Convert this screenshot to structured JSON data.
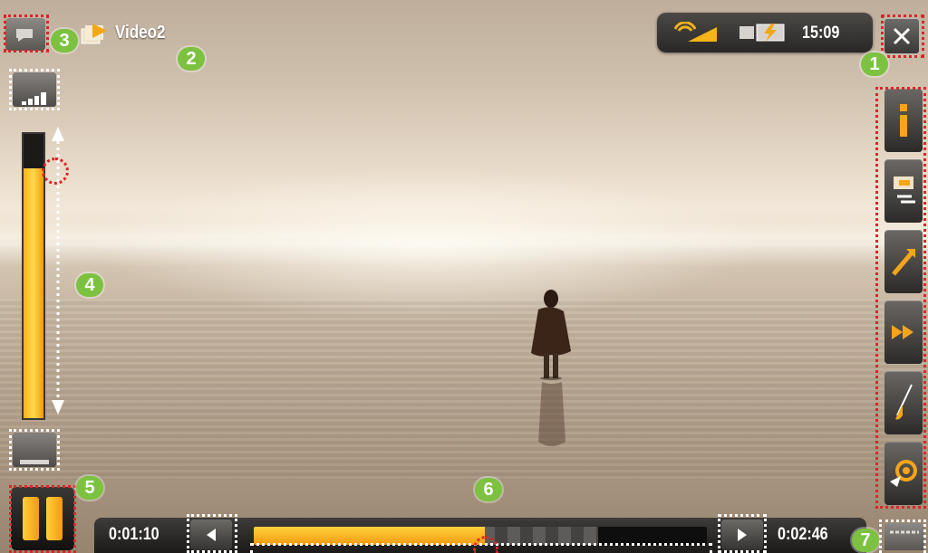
{
  "header": {
    "title": "Video2",
    "back_icon": "back-icon",
    "folder_icon": "folder-video-icon"
  },
  "status": {
    "clock": "15:09",
    "wifi_icon": "wifi-signal-icon",
    "battery_icon": "battery-charging-icon",
    "close_icon": "close-icon"
  },
  "volume": {
    "level_percent": 88,
    "up_icon": "volume-up-icon",
    "down_icon": "volume-down-icon"
  },
  "side_menu": {
    "items": [
      {
        "icon": "info-icon"
      },
      {
        "icon": "subtitle-icon"
      },
      {
        "icon": "resize-icon"
      },
      {
        "icon": "fast-forward-icon"
      },
      {
        "icon": "settings-icon"
      },
      {
        "icon": "bookmark-icon"
      }
    ],
    "menu_icon": "menu-icon"
  },
  "playback": {
    "state": "playing",
    "pause_icon": "pause-icon",
    "elapsed": "0:01:10",
    "total": "0:02:46",
    "progress_percent": 51,
    "buffered_percent": 76,
    "prev_icon": "seek-back-icon",
    "next_icon": "seek-forward-icon"
  },
  "callouts": {
    "c1": "1",
    "c2": "2",
    "c3": "3",
    "c4": "4",
    "c5": "5",
    "c6": "6",
    "c7": "7"
  },
  "colors": {
    "accent": "#f7b21b",
    "callout": "#7cc240",
    "highlight_red": "#d8262b"
  }
}
